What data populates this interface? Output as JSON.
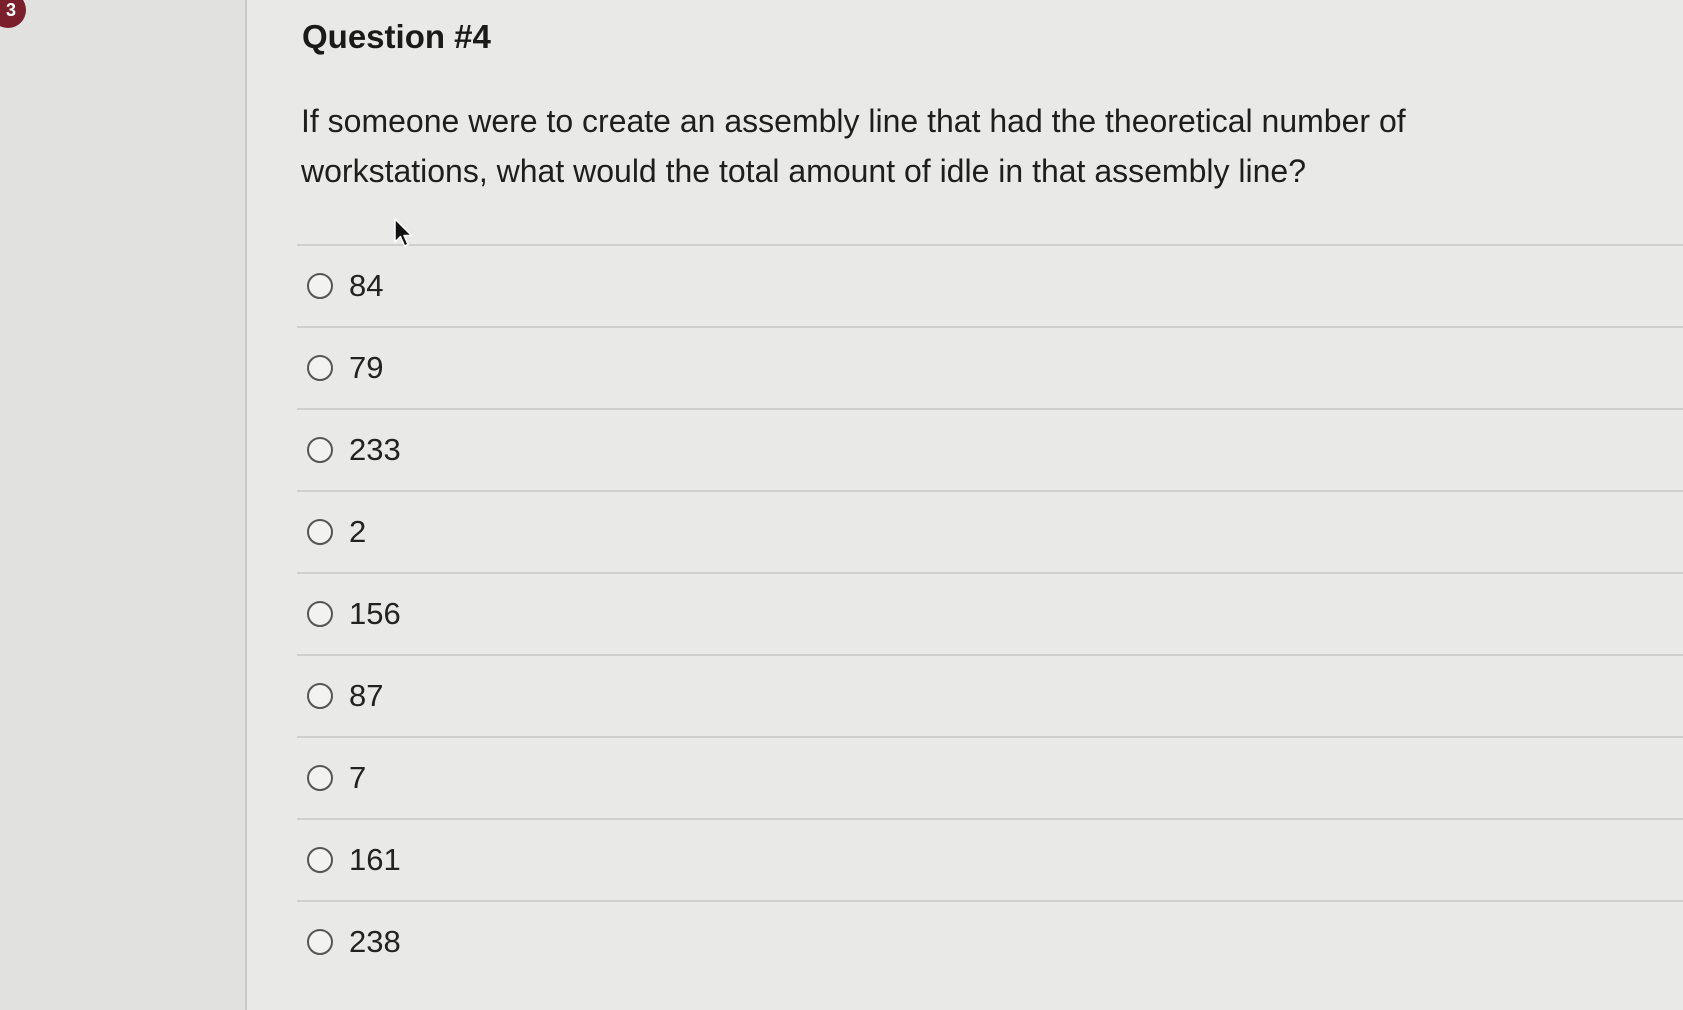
{
  "badge": {
    "number": "3"
  },
  "question": {
    "title": "Question #4",
    "text": "If someone were to create an assembly line that had the theoretical number of workstations, what would the total amount of idle in that assembly line?",
    "options": [
      {
        "label": "84"
      },
      {
        "label": "79"
      },
      {
        "label": "233"
      },
      {
        "label": "2"
      },
      {
        "label": "156"
      },
      {
        "label": "87"
      },
      {
        "label": "7"
      },
      {
        "label": "161"
      },
      {
        "label": "238"
      }
    ]
  },
  "colors": {
    "badge_background": "#7a1f2b",
    "page_background": "#e9e9e7"
  },
  "icons": {
    "cursor": "mouse-pointer-icon",
    "radio": "radio-unchecked-icon"
  }
}
